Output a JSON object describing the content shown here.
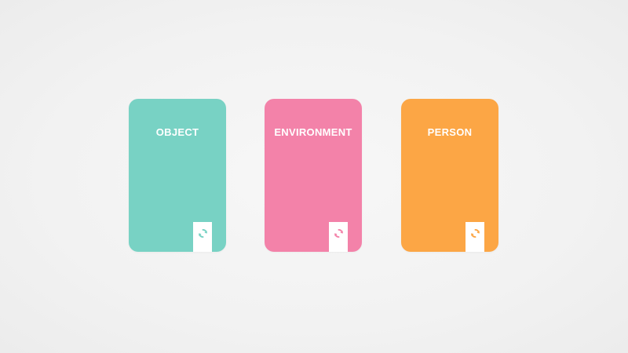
{
  "cards": [
    {
      "title": "OBJECT",
      "color": "#78d2c4",
      "icon": "refresh-icon"
    },
    {
      "title": "ENVIRONMENT",
      "color": "#f382a9",
      "icon": "refresh-icon"
    },
    {
      "title": "PERSON",
      "color": "#fca645",
      "icon": "refresh-icon"
    }
  ]
}
